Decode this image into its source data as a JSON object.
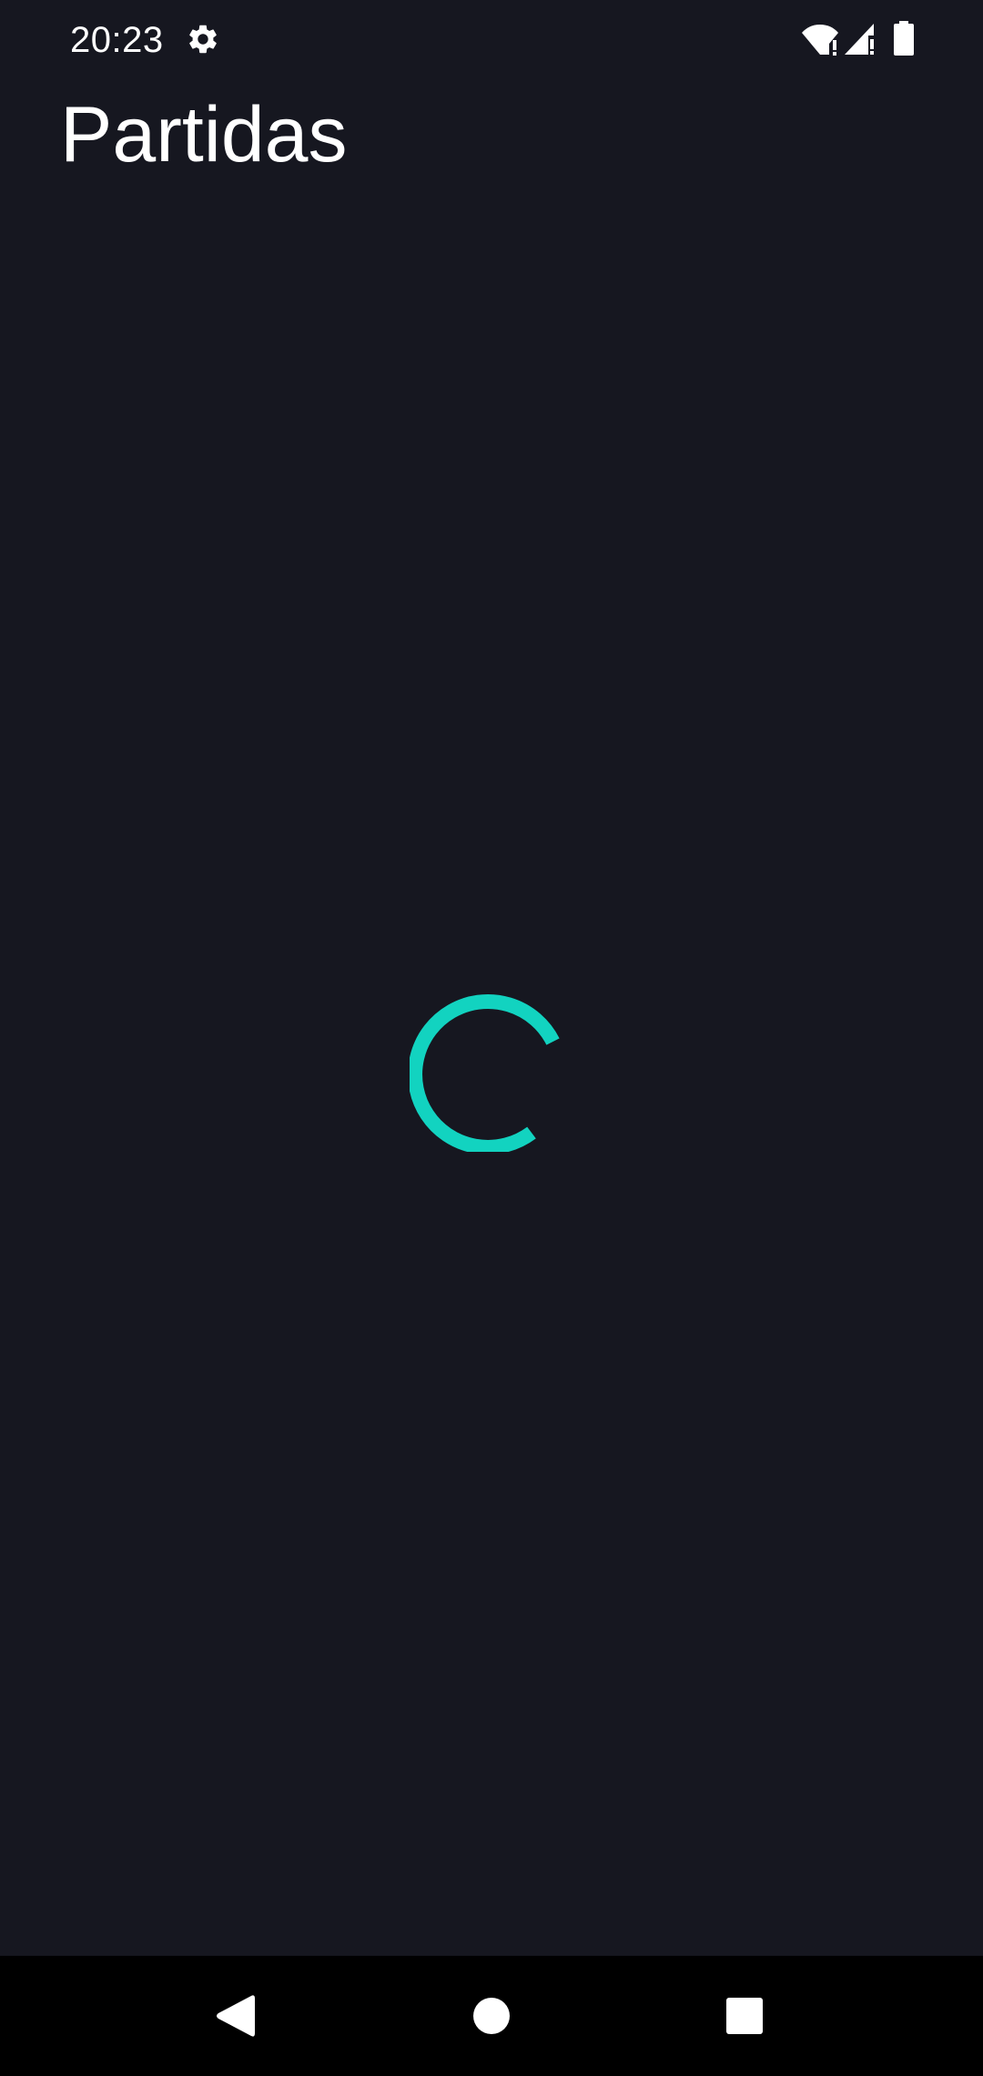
{
  "status_bar": {
    "time": "20:23",
    "icons": [
      "gear-icon",
      "wifi-alert-icon",
      "signal-alert-icon",
      "battery-icon"
    ]
  },
  "header": {
    "title": "Partidas"
  },
  "main": {
    "state": "loading",
    "spinner_icon": "loading-spinner-icon"
  },
  "nav_bar": {
    "buttons": [
      "back-icon",
      "home-icon",
      "recents-icon"
    ]
  },
  "colors": {
    "background": "#161720",
    "accent": "#12D3C0",
    "text": "#FFFFFF",
    "nav_background": "#000000"
  }
}
